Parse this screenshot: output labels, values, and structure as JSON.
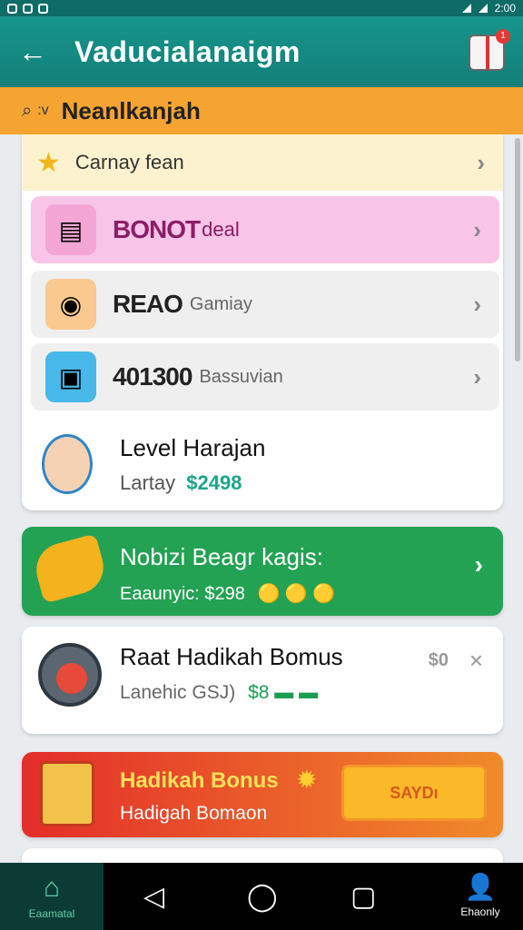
{
  "status_bar": {
    "time": "2:00"
  },
  "app_bar": {
    "title": "Vaducialanaigm",
    "back_icon": "←",
    "gift_badge": "1"
  },
  "sub_bar": {
    "icon": "⌕",
    "v": ":v",
    "title": "Neanlkanjah"
  },
  "list": {
    "rows": [
      {
        "icon": "★",
        "label_big": "",
        "label_small": "Carnay fean"
      },
      {
        "icon": "▤",
        "label_big": "BONOT",
        "label_small": "deal"
      },
      {
        "icon": "◉",
        "label_big": "REAO",
        "label_small": "Gamiay"
      },
      {
        "icon": "▣",
        "label_big": "401300",
        "label_small": "Bassuvian"
      }
    ],
    "level": {
      "title": "Level Harajan",
      "sub_label": "Lartay",
      "amount": "$2498"
    }
  },
  "green_card": {
    "title": "Nobizi Beagr kagis:",
    "sub": "Eaaunyic: $298",
    "coins": "🟡 🟡 🟡"
  },
  "white_card": {
    "title": "Raat Hadikah Bomus",
    "sub": "Lanehic GSJ)",
    "coins": "$8 ▬ ▬",
    "badge": "$0",
    "close": "×"
  },
  "bonus_card": {
    "title": "Hadikah Bonus",
    "sub": "Hadigah Bomaon",
    "button": "SAYDı"
  },
  "nav": {
    "home_label": "Eaamatal",
    "profile_label": "Ehaonly"
  },
  "colors": {
    "primary": "#17958c",
    "accent": "#f5a431",
    "green": "#23a254",
    "red": "#e32d2a"
  }
}
